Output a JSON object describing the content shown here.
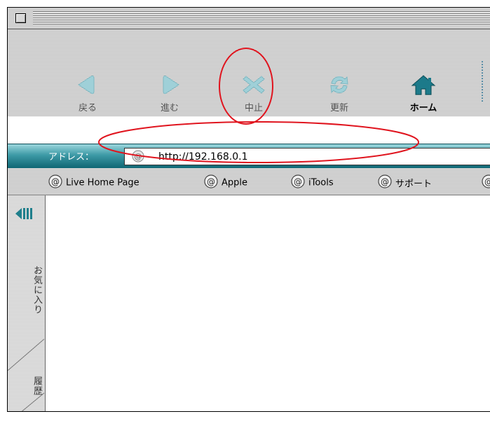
{
  "toolbar": {
    "back_label": "戻る",
    "forward_label": "進む",
    "stop_label": "中止",
    "refresh_label": "更新",
    "home_label": "ホーム"
  },
  "address": {
    "label": "アドレス：",
    "url": "http://192.168.0.1"
  },
  "favorites_bar": {
    "items": [
      {
        "label": "Live Home Page"
      },
      {
        "label": "Apple"
      },
      {
        "label": "iTools"
      },
      {
        "label": "サポート"
      }
    ]
  },
  "sidebar": {
    "tabs": [
      {
        "label": "お気に入り"
      },
      {
        "label": "履歴"
      }
    ]
  },
  "colors": {
    "accent_teal": "#1f7f8c",
    "annotation_red": "#e0141e",
    "icon_light_teal": "#9fd0d8",
    "home_teal": "#1c7a8a"
  },
  "icons": [
    "back-arrow-icon",
    "forward-arrow-icon",
    "stop-x-icon",
    "refresh-icon",
    "home-icon",
    "at-sign-icon",
    "sidebar-collapse-icon"
  ]
}
